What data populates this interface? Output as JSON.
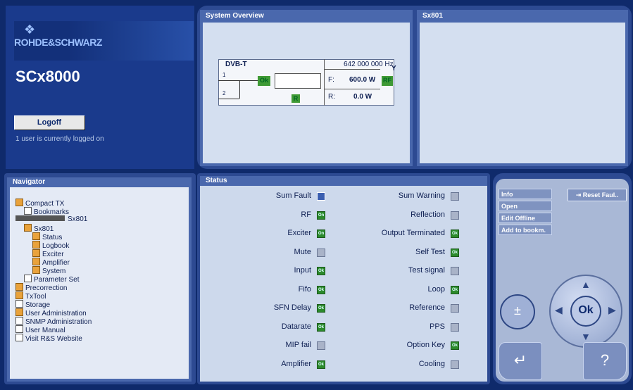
{
  "branding": {
    "logo_text": "ROHDE&SCHWARZ",
    "product": "SCx8000",
    "logoff_label": "Logoff",
    "user_status": "1 user is currently logged on"
  },
  "system_overview": {
    "title": "System Overview",
    "standard": "DVB-T",
    "frequency": "642 000 000 Hz",
    "forward_label": "F:",
    "forward_value": "600.0 W",
    "reflected_label": "R:",
    "reflected_value": "0.0 W",
    "ok_badge": "Ok",
    "rf_badge": "RF",
    "r_badge": "R",
    "input1": "1",
    "input2": "2"
  },
  "sx801_panel": {
    "title": "Sx801"
  },
  "navigator": {
    "title": "Navigator",
    "items": [
      {
        "label": "Compact TX",
        "indent": 0,
        "icon": "folder-icon"
      },
      {
        "label": "Bookmarks",
        "indent": 1,
        "icon": "bookmark-icon"
      },
      {
        "label": "Sx801",
        "indent": 0,
        "icon": "device-icon"
      },
      {
        "label": "Sx801",
        "indent": 1,
        "icon": "folder-icon"
      },
      {
        "label": "Status",
        "indent": 2,
        "icon": "folder-icon"
      },
      {
        "label": "Logbook",
        "indent": 2,
        "icon": "folder-icon"
      },
      {
        "label": "Exciter",
        "indent": 2,
        "icon": "folder-icon"
      },
      {
        "label": "Amplifier",
        "indent": 2,
        "icon": "folder-icon"
      },
      {
        "label": "System",
        "indent": 2,
        "icon": "folder-icon"
      },
      {
        "label": "Parameter Set",
        "indent": 1,
        "icon": "document-icon"
      },
      {
        "label": "Precorrection",
        "indent": 0,
        "icon": "chart-icon"
      },
      {
        "label": "TxTool",
        "indent": 0,
        "icon": "tool-icon"
      },
      {
        "label": "Storage",
        "indent": 0,
        "icon": "document-icon"
      },
      {
        "label": "User Administration",
        "indent": 0,
        "icon": "users-icon"
      },
      {
        "label": "SNMP Administration",
        "indent": 0,
        "icon": "document-icon"
      },
      {
        "label": "User Manual",
        "indent": 0,
        "icon": "document-icon"
      },
      {
        "label": "Visit R&S Website",
        "indent": 0,
        "icon": "document-icon"
      }
    ]
  },
  "status": {
    "title": "Status",
    "left": [
      {
        "label": "Sum Fault",
        "state": "selected",
        "text": ""
      },
      {
        "label": "RF",
        "state": "on",
        "text": "On"
      },
      {
        "label": "Exciter",
        "state": "on",
        "text": "On"
      },
      {
        "label": "Mute",
        "state": "off",
        "text": ""
      },
      {
        "label": "Input",
        "state": "on",
        "text": "Ok"
      },
      {
        "label": "Fifo",
        "state": "on",
        "text": "Ok"
      },
      {
        "label": "SFN Delay",
        "state": "on",
        "text": "Ok"
      },
      {
        "label": "Datarate",
        "state": "on",
        "text": "Ok"
      },
      {
        "label": "MIP fail",
        "state": "off",
        "text": ""
      },
      {
        "label": "Amplifier",
        "state": "on",
        "text": "Ok"
      }
    ],
    "right": [
      {
        "label": "Sum Warning",
        "state": "off",
        "text": ""
      },
      {
        "label": "Reflection",
        "state": "off",
        "text": ""
      },
      {
        "label": "Output Terminated",
        "state": "on",
        "text": "Ok"
      },
      {
        "label": "Self Test",
        "state": "on",
        "text": "Ok"
      },
      {
        "label": "Test signal",
        "state": "off",
        "text": ""
      },
      {
        "label": "Loop",
        "state": "on",
        "text": "Ok"
      },
      {
        "label": "Reference",
        "state": "off",
        "text": ""
      },
      {
        "label": "PPS",
        "state": "off",
        "text": ""
      },
      {
        "label": "Option Key",
        "state": "on",
        "text": "Ok"
      },
      {
        "label": "Cooling",
        "state": "off",
        "text": ""
      }
    ]
  },
  "controls": {
    "menu": [
      "Info",
      "Open",
      "Edit Offline",
      "Add to bookm."
    ],
    "reset_label": "Reset Faul..",
    "ok_label": "Ok",
    "zoom_label": "±",
    "back_label": "↵",
    "help_label": "?"
  },
  "colors": {
    "background": "#0f2a6b",
    "panel": "#c9d6ea",
    "ok_green": "#2c8a2c"
  }
}
